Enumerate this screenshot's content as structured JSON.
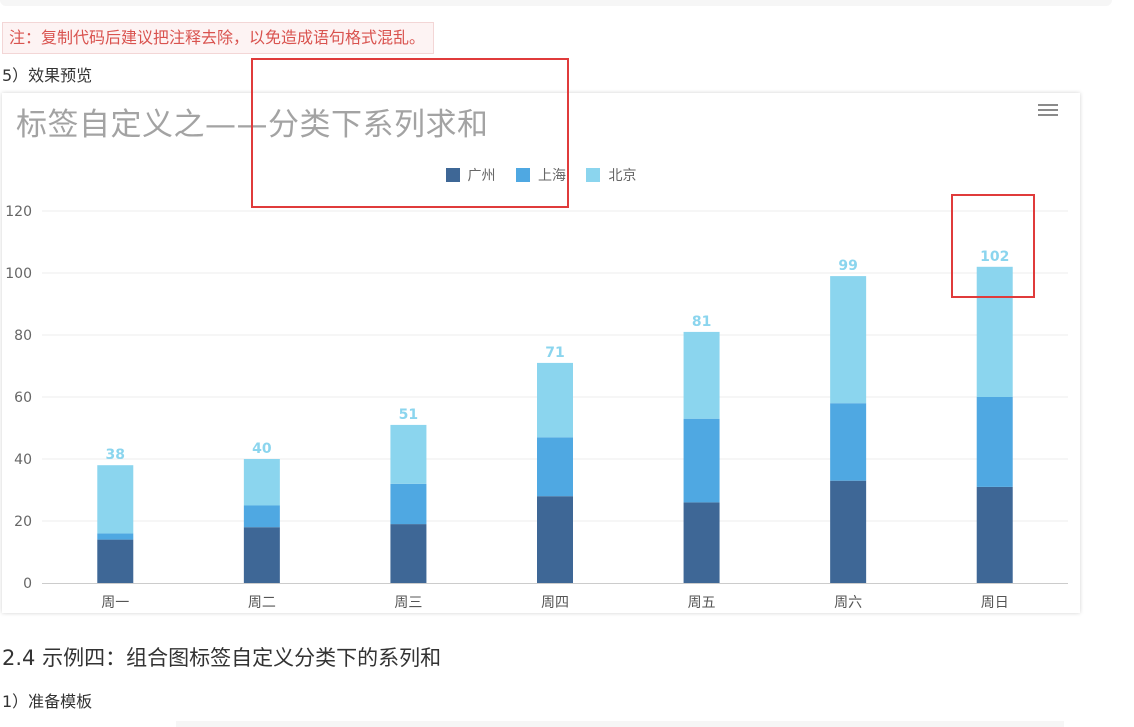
{
  "note": {
    "text": "注：复制代码后建议把注释去除，以免造成语句格式混乱。"
  },
  "steps": {
    "preview": "5）效果预览",
    "prepare": "1）准备模板"
  },
  "section": {
    "heading": "2.4 示例四：组合图标签自定义分类下的系列和"
  },
  "icons": {
    "chart_menu": "hamburger-menu-icon"
  },
  "colors": {
    "guangzhou": "#3e6796",
    "shanghai": "#4fa8e2",
    "beijing": "#8bd5ee",
    "total_label": "#8bd5ee",
    "highlight": "#e03b3b"
  },
  "chart_data": {
    "type": "bar",
    "stacked": true,
    "title": "标签自定义之——分类下系列求和",
    "categories": [
      "周一",
      "周二",
      "周三",
      "周四",
      "周五",
      "周六",
      "周日"
    ],
    "series": [
      {
        "name": "广州",
        "values": [
          14,
          18,
          19,
          28,
          26,
          33,
          31
        ]
      },
      {
        "name": "上海",
        "values": [
          2,
          7,
          13,
          19,
          27,
          25,
          29
        ]
      },
      {
        "name": "北京",
        "values": [
          22,
          15,
          19,
          24,
          28,
          41,
          42
        ]
      }
    ],
    "totals": [
      38,
      40,
      51,
      71,
      81,
      99,
      102
    ],
    "yticks": [
      0,
      20,
      40,
      60,
      80,
      100,
      120
    ],
    "ylim": [
      0,
      120
    ],
    "grid": true,
    "legend_position": "top-center"
  }
}
